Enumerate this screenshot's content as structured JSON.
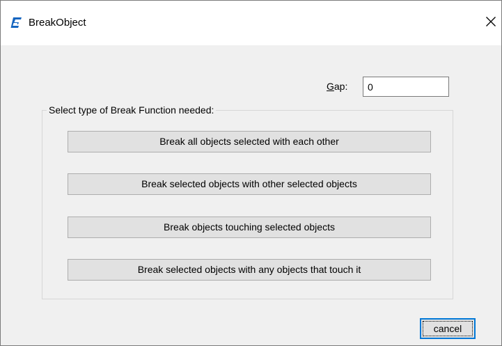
{
  "window": {
    "title": "BreakObject",
    "close_symbol": "✕",
    "app_icon": "gstarcad-logo-icon",
    "accent_color": "#0078d7"
  },
  "gap": {
    "label_underlined": "G",
    "label_rest": "ap:",
    "value": "0"
  },
  "group": {
    "legend": "Select type of Break Function needed:",
    "buttons": [
      "Break all objects selected with each other",
      "Break selected objects with other selected objects",
      "Break objects touching selected objects",
      "Break selected objects with any objects that touch it"
    ]
  },
  "footer": {
    "cancel_label": "cancel"
  }
}
